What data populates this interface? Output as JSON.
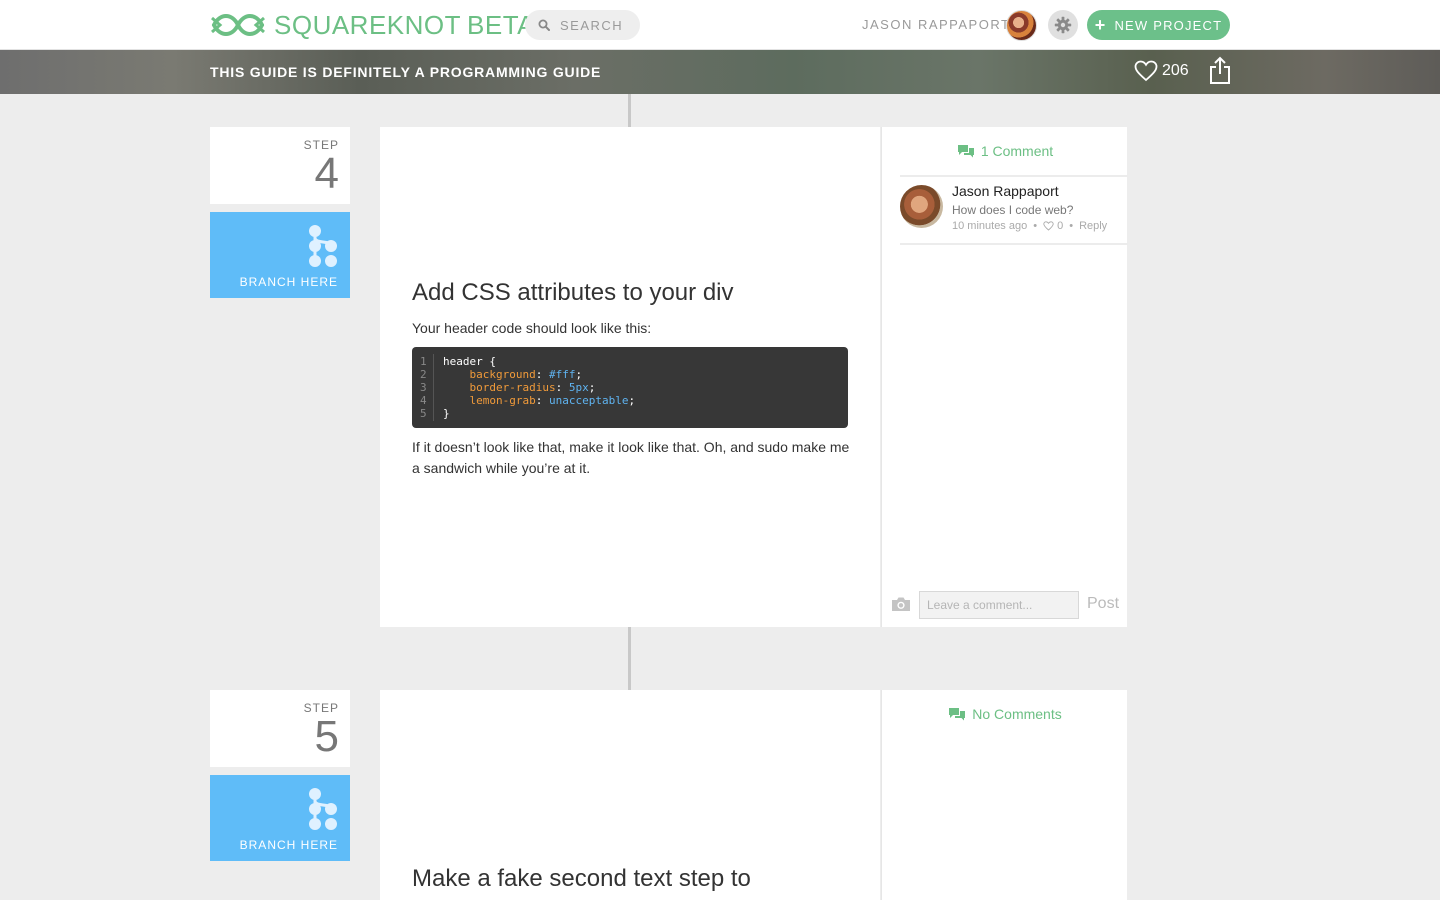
{
  "nav": {
    "brand": "SQUAREKNOT",
    "brand_suffix": "BETA",
    "search_placeholder": "SEARCH",
    "username": "JASON RAPPAPORT",
    "new_project_label": "NEW PROJECT",
    "accent_color": "#6cbf84"
  },
  "guide": {
    "title": "THIS GUIDE IS DEFINITELY A PROGRAMMING GUIDE",
    "likes": "206"
  },
  "steps": [
    {
      "step_label": "STEP",
      "number": "4",
      "branch_label": "BRANCH HERE",
      "title": "Add CSS attributes to your div",
      "intro": "Your header code should look like this:",
      "code": {
        "line_numbers": [
          "1",
          "2",
          "3",
          "4",
          "5"
        ],
        "selector": "header {",
        "lines": [
          {
            "prop": "background",
            "value": "#fff"
          },
          {
            "prop": "border-radius",
            "value": "5px"
          },
          {
            "prop": "lemon-grab",
            "value": "unacceptable"
          }
        ],
        "close": "}"
      },
      "outro": "If it doesn’t look like that, make it look like that. Oh, and sudo make me a sandwich while you’re at it.",
      "comments": {
        "header": "1 Comment",
        "items": [
          {
            "name": "Jason Rappaport",
            "text": "How does I code web?",
            "time": "10 minutes ago",
            "likes": "0",
            "reply": "Reply"
          }
        ],
        "input_placeholder": "Leave a comment...",
        "post_label": "Post"
      }
    },
    {
      "step_label": "STEP",
      "number": "5",
      "branch_label": "BRANCH HERE",
      "title": "Make a fake second text step to",
      "comments": {
        "header": "No Comments"
      }
    }
  ]
}
